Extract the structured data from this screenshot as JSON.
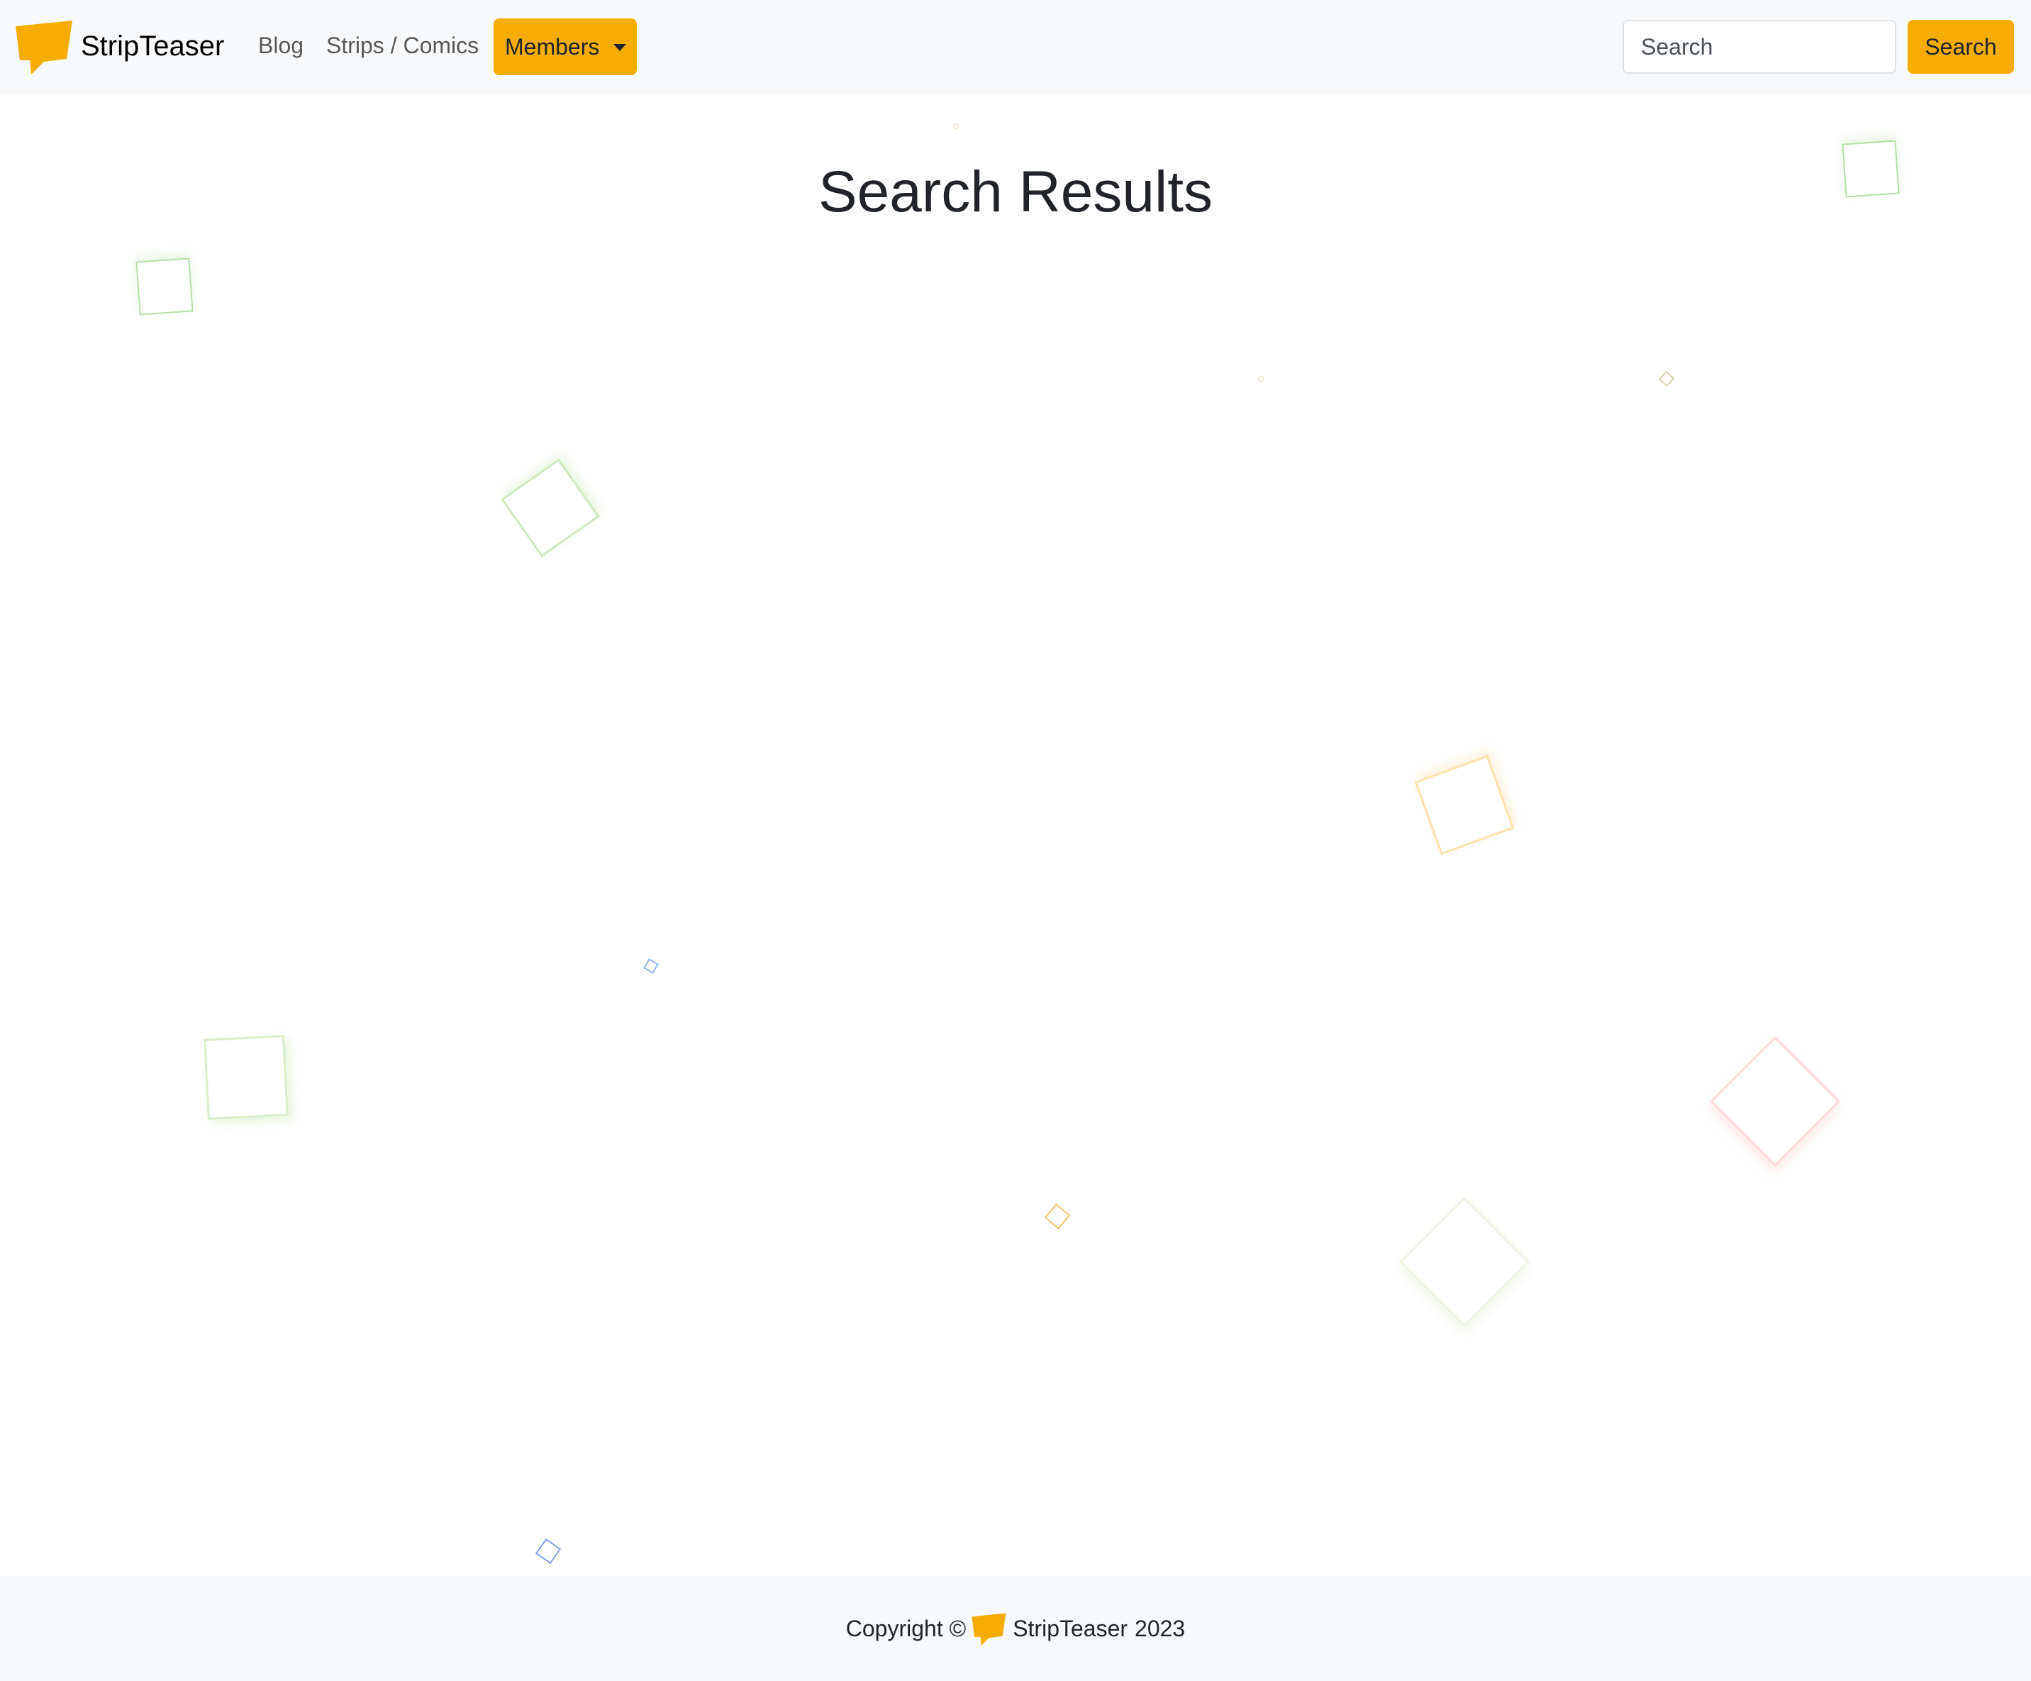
{
  "navbar": {
    "brand": "StripTeaser",
    "links": {
      "blog": "Blog",
      "strips": "Strips / Comics"
    },
    "members_label": "Members",
    "search_placeholder": "Search",
    "search_button": "Search"
  },
  "main": {
    "title": "Search Results"
  },
  "footer": {
    "copyright": "Copyright ©",
    "brand": "StripTeaser",
    "year": "2023"
  },
  "colors": {
    "accent": "#f4ad00",
    "navbar_bg": "#f8f9fa"
  },
  "icons": {
    "brand": "speech-bubble-logo",
    "members_dropdown": "caret-down-icon"
  }
}
